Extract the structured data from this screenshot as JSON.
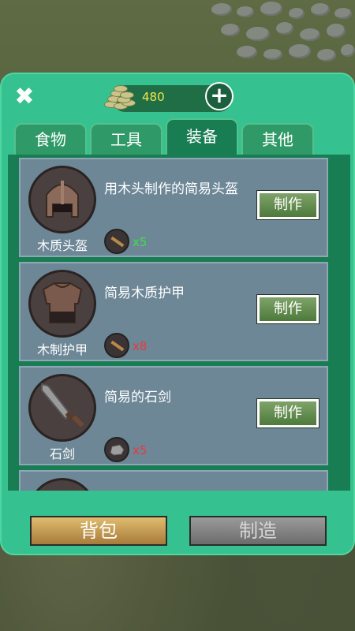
{
  "currency": {
    "amount": "480",
    "plus_label": "+"
  },
  "close_label": "✖",
  "tabs": [
    {
      "label": "食物",
      "active": false
    },
    {
      "label": "工具",
      "active": false
    },
    {
      "label": "装备",
      "active": true
    },
    {
      "label": "其他",
      "active": false
    }
  ],
  "recipes": [
    {
      "name": "木质头盔",
      "desc": "用木头制作的简易头盔",
      "material": "wood-stick-icon",
      "qty": "x5",
      "enough": true,
      "button": "制作"
    },
    {
      "name": "木制护甲",
      "desc": "简易木质护甲",
      "material": "wood-stick-icon",
      "qty": "x8",
      "enough": false,
      "button": "制作"
    },
    {
      "name": "石剑",
      "desc": "简易的石剑",
      "material": "stone-icon",
      "qty": "x5",
      "enough": false,
      "button": "制作"
    }
  ],
  "bottom": {
    "bag_label": "背包",
    "make_label": "制造"
  },
  "colors": {
    "panel": "#35c190",
    "list_bg": "#187d52",
    "card": "#6d8797",
    "qty_ok": "#3de04a",
    "qty_bad": "#e83a3a"
  }
}
